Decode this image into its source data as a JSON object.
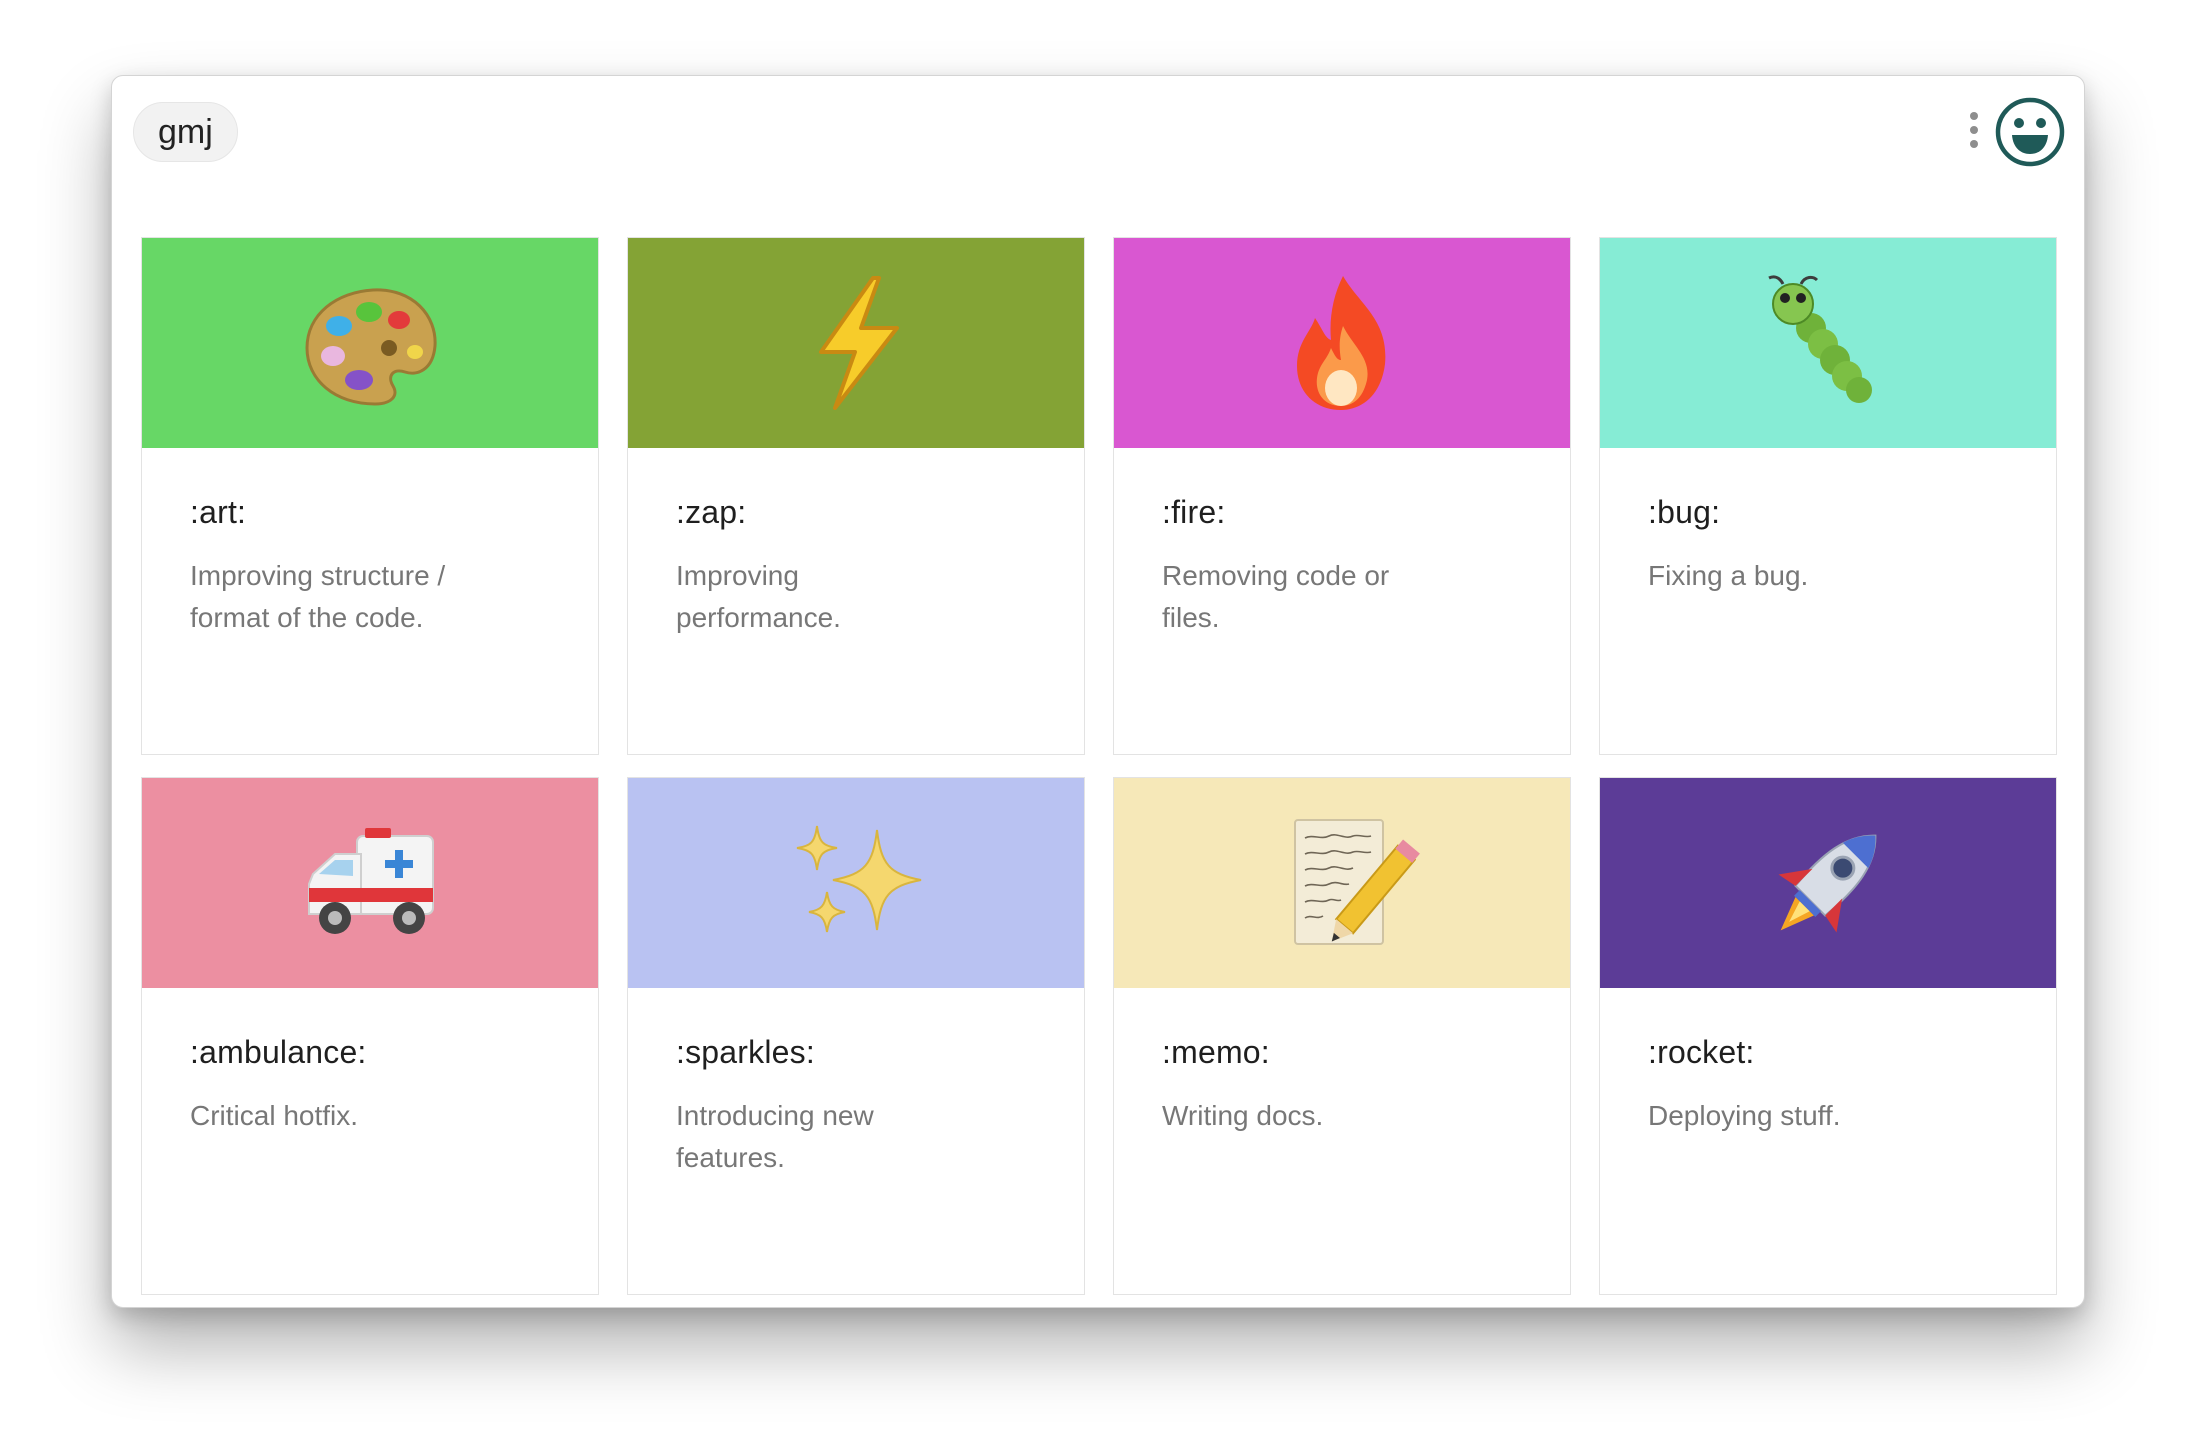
{
  "search": {
    "value": "gmj"
  },
  "header": {
    "menu_icon": "vertical-dots-icon",
    "logo_icon": "grinning-face-icon"
  },
  "cards": [
    {
      "code": ":art:",
      "description": "Improving structure / format of the code.",
      "color": "#67d766",
      "icon": "artist-palette-icon"
    },
    {
      "code": ":zap:",
      "description": "Improving performance.",
      "color": "#84a335",
      "icon": "high-voltage-icon"
    },
    {
      "code": ":fire:",
      "description": "Removing code or files.",
      "color": "#d957d1",
      "icon": "fire-icon"
    },
    {
      "code": ":bug:",
      "description": "Fixing a bug.",
      "color": "#86ecd5",
      "icon": "bug-icon"
    },
    {
      "code": ":ambulance:",
      "description": "Critical hotfix.",
      "color": "#ec8fa1",
      "icon": "ambulance-icon"
    },
    {
      "code": ":sparkles:",
      "description": "Introducing new features.",
      "color": "#b9c2f2",
      "icon": "sparkles-icon"
    },
    {
      "code": ":memo:",
      "description": "Writing docs.",
      "color": "#f6e8b8",
      "icon": "memo-icon"
    },
    {
      "code": ":rocket:",
      "description": "Deploying stuff.",
      "color": "#5c3c97",
      "icon": "rocket-icon"
    }
  ]
}
